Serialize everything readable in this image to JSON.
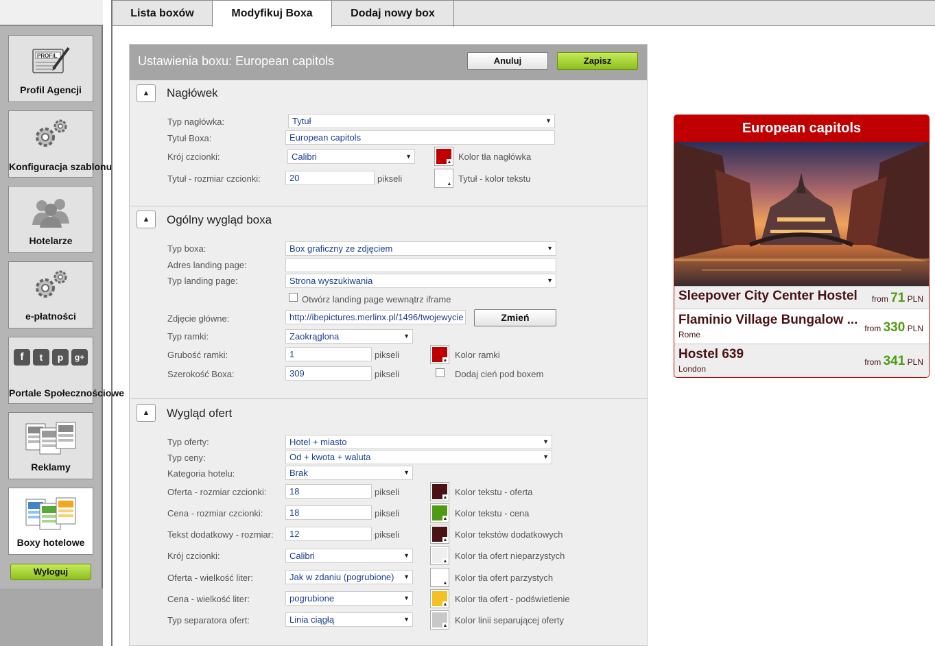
{
  "sidebar": {
    "items": [
      {
        "label": "Profil Agencji",
        "icon": "profile-card-icon",
        "badge": "PROFIL"
      },
      {
        "label": "Konfiguracja szablonu",
        "icon": "gears-icon"
      },
      {
        "label": "Hotelarze",
        "icon": "users-icon"
      },
      {
        "label": "e-płatności",
        "icon": "gears-icon"
      },
      {
        "label": "Portale Społecznościowe",
        "icon": "social-icons",
        "social": [
          "f",
          "t",
          "p",
          "g+"
        ]
      },
      {
        "label": "Reklamy",
        "icon": "ads-icon"
      },
      {
        "label": "Boxy hotelowe",
        "icon": "hotel-boxes-icon"
      }
    ],
    "logout_label": "Wyloguj"
  },
  "tabs": [
    {
      "label": "Lista boxów"
    },
    {
      "label": "Modyfikuj Boxa"
    },
    {
      "label": "Dodaj nowy box"
    }
  ],
  "panel": {
    "title": "Ustawienia boxu: European capitols",
    "cancel_label": "Anuluj",
    "save_label": "Zapisz",
    "sections": {
      "header": {
        "title": "Nagłówek",
        "type_label": "Typ nagłówka:",
        "type_value": "Tytuł",
        "box_title_label": "Tytuł Boxa:",
        "box_title_value": "European capitols",
        "font_label": "Krój czcionki:",
        "font_value": "Calibri",
        "bg_color_label": "Kolor tła nagłówka",
        "bg_color": "#c00000",
        "size_label": "Tytuł - rozmiar czcionki:",
        "size_value": "20",
        "unit": "pikseli",
        "text_color_label": "Tytuł - kolor tekstu",
        "text_color": "#ffffff"
      },
      "look": {
        "title": "Ogólny wygląd boxa",
        "box_type_label": "Typ boxa:",
        "box_type_value": "Box graficzny ze zdjęciem",
        "landing_addr_label": "Adres landing page:",
        "landing_addr_value": "",
        "landing_type_label": "Typ landing page:",
        "landing_type_value": "Strona wyszukiwania",
        "iframe_label": "Otwórz landing page wewnątrz iframe",
        "photo_label": "Zdjęcie główne:",
        "photo_value": "http://ibepictures.merlinx.pl/1496/twojewycie",
        "change_label": "Zmień",
        "frame_type_label": "Typ ramki:",
        "frame_type_value": "Zaokrąglona",
        "frame_width_label": "Grubość ramki:",
        "frame_width_value": "1",
        "unit": "pikseli",
        "frame_color_label": "Kolor ramki",
        "frame_color": "#c00000",
        "box_width_label": "Szerokość Boxa:",
        "box_width_value": "309",
        "shadow_label": "Dodaj cień pod boxem"
      },
      "offers": {
        "title": "Wygląd ofert",
        "offer_type_label": "Typ oferty:",
        "offer_type_value": "Hotel + miasto",
        "price_type_label": "Typ ceny:",
        "price_type_value": "Od + kwota + waluta",
        "category_label": "Kategoria hotelu:",
        "category_value": "Brak",
        "offer_size_label": "Oferta - rozmiar czcionki:",
        "offer_size_value": "18",
        "price_size_label": "Cena - rozmiar czcionki:",
        "price_size_value": "18",
        "extra_size_label": "Tekst dodatkowy - rozmiar:",
        "extra_size_value": "12",
        "unit": "pikseli",
        "font_label": "Krój czcionki:",
        "font_value": "Calibri",
        "case_label": "Oferta - wielkość liter:",
        "case_value": "Jak w zdaniu (pogrubione)",
        "price_case_label": "Cena - wielkość liter:",
        "price_case_value": "pogrubione",
        "separator_label": "Typ separatora ofert:",
        "separator_value": "Linia ciągłą",
        "colors": [
          {
            "label": "Kolor tekstu - oferta",
            "color": "#4a1212"
          },
          {
            "label": "Kolor tekstu - cena",
            "color": "#4f9a12"
          },
          {
            "label": "Kolor tekstów dodatkowych",
            "color": "#4a1212"
          },
          {
            "label": "Kolor tła ofert nieparzystych",
            "color": "#eeeeee"
          },
          {
            "label": "Kolor tła ofert parzystych",
            "color": "#ffffff"
          },
          {
            "label": "Kolor tła ofert - podświetlenie",
            "color": "#f5c023"
          },
          {
            "label": "Kolor linii separującej oferty",
            "color": "#c8c8c8"
          }
        ]
      }
    }
  },
  "preview": {
    "title": "European capitols",
    "offers": [
      {
        "name": "Sleepover City Center Hostel",
        "city": "",
        "from": "from",
        "price": "71",
        "currency": "PLN"
      },
      {
        "name": "Flaminio Village Bungalow ...",
        "city": "Rome",
        "from": "from",
        "price": "330",
        "currency": "PLN"
      },
      {
        "name": "Hostel 639",
        "city": "London",
        "from": "from",
        "price": "341",
        "currency": "PLN"
      }
    ]
  }
}
